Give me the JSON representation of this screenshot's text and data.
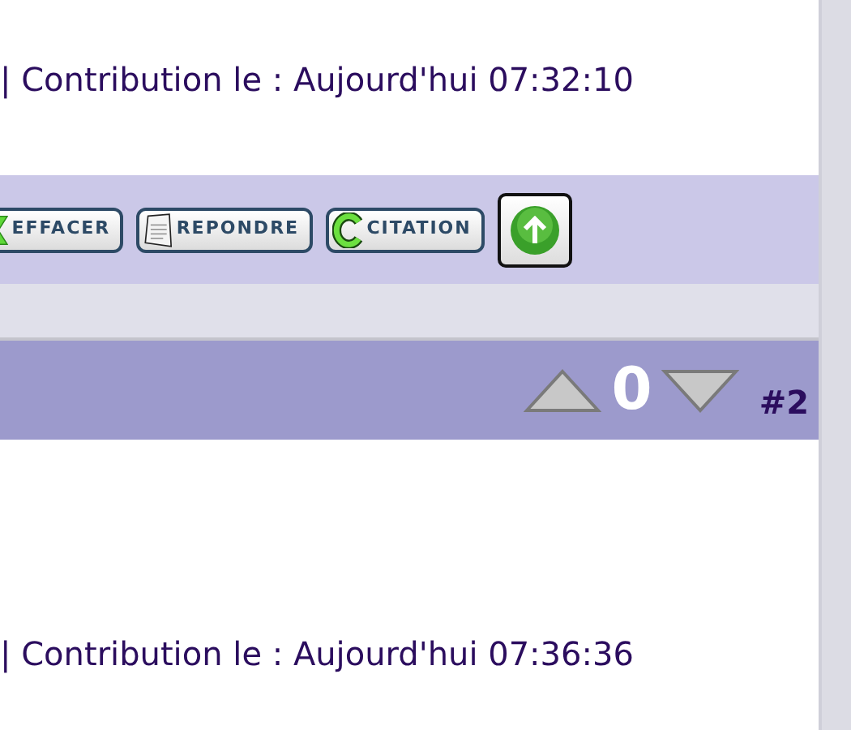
{
  "post_1": {
    "footer_text": "| Contribution le : Aujourd'hui 07:32:10",
    "actions": [
      {
        "kind": "delete",
        "label": "EFFACER"
      },
      {
        "kind": "reply",
        "label": "REPONDRE"
      },
      {
        "kind": "quote",
        "label": "CITATION"
      },
      {
        "kind": "top"
      }
    ]
  },
  "post_2": {
    "vote_score": "0",
    "post_number": "#2",
    "footer_text": "| Contribution le : Aujourd'hui 07:36:36"
  }
}
